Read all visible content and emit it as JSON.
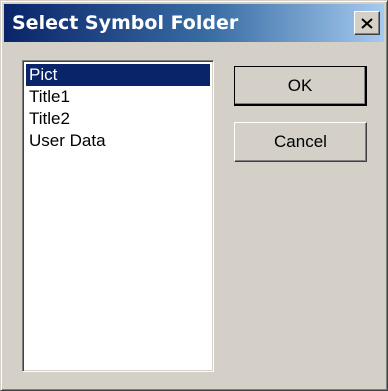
{
  "window": {
    "title": "Select Symbol Folder",
    "close_icon": "close-icon"
  },
  "folders": {
    "items": [
      {
        "label": "Pict",
        "selected": true
      },
      {
        "label": "Title1",
        "selected": false
      },
      {
        "label": "Title2",
        "selected": false
      },
      {
        "label": "User Data",
        "selected": false
      }
    ]
  },
  "buttons": {
    "ok_label": "OK",
    "cancel_label": "Cancel"
  },
  "colors": {
    "titlebar_start": "#0a246a",
    "titlebar_end": "#a6caf0",
    "dialog_bg": "#d4d0c8",
    "selection": "#0a246a"
  }
}
